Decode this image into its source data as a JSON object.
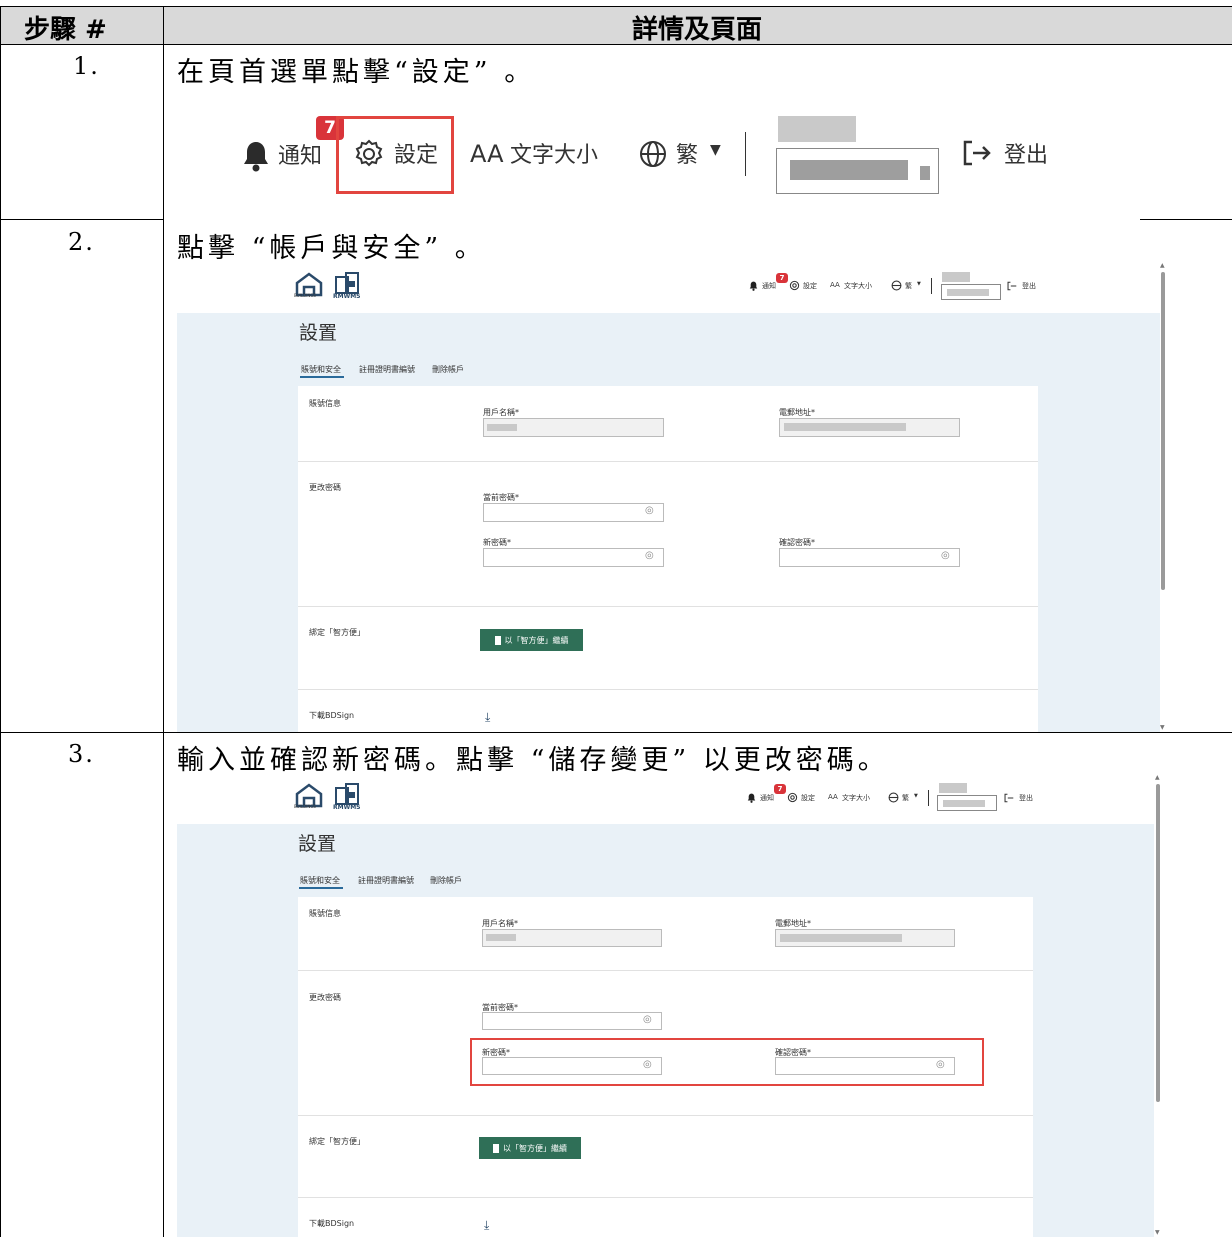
{
  "header": {
    "col1": "步驟 #",
    "col2": "詳情及頁面"
  },
  "steps": [
    {
      "number": "1.",
      "text": "在頁首選單點擊“設定” 。"
    },
    {
      "number": "2.",
      "text": "點擊 “帳戶與安全” 。"
    },
    {
      "number": "3.",
      "text": "輸入並確認新密碼。點擊 “儲存變更” 以更改密碼。"
    }
  ],
  "toolbar": {
    "notify_label": "通知",
    "notify_count": "7",
    "settings_label": "設定",
    "font_size_label": "文字大小",
    "font_size_icon": "AA",
    "language_label": "繁",
    "logout_label": "登出"
  },
  "settings_page": {
    "logo_sub": "BUILDINGS",
    "logo_text": "RMWMS",
    "title": "設置",
    "tabs": [
      "賬號和安全",
      "註冊證明書編號",
      "刪除帳戶"
    ],
    "account_section": "賬號信息",
    "username_label": "用戶名稱*",
    "email_label": "電郵地址*",
    "password_section": "更改密碼",
    "current_password_label": "當前密碼*",
    "new_password_label": "新密碼*",
    "confirm_password_label": "確認密碼*",
    "bind_section": "綁定「智方便」",
    "bind_button": "以「智方便」繼續",
    "download_label": "下載BDSign"
  },
  "colors": {
    "accent_green": "#2f6f57",
    "highlight_red": "#e2453f",
    "badge_red": "#d9343a",
    "page_band": "#e9f1f7"
  }
}
